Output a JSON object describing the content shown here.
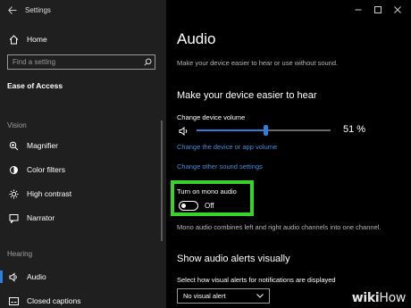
{
  "window": {
    "title": "Settings",
    "back_icon": "back-arrow-icon",
    "controls": [
      "minimize",
      "maximize",
      "close"
    ]
  },
  "sidebar": {
    "home_label": "Home",
    "search_placeholder": "Find a setting",
    "section_title": "Ease of Access",
    "vision_label": "Vision",
    "vision_items": [
      {
        "label": "Magnifier",
        "icon": "magnifier-icon"
      },
      {
        "label": "Color filters",
        "icon": "color-filters-icon"
      },
      {
        "label": "High contrast",
        "icon": "high-contrast-icon"
      },
      {
        "label": "Narrator",
        "icon": "narrator-icon"
      }
    ],
    "hearing_label": "Hearing",
    "hearing_items": [
      {
        "label": "Audio",
        "icon": "audio-icon",
        "selected": true
      },
      {
        "label": "Closed captions",
        "icon": "closed-captions-icon"
      }
    ],
    "accent_color": "#2e7fd9"
  },
  "main": {
    "title": "Audio",
    "subtitle": "Make your device easier to hear or use without sound.",
    "section1_heading": "Make your device easier to hear",
    "volume_label": "Change device volume",
    "volume_percent": 51,
    "volume_display": "51 %",
    "link_app_volume": "Change the device or app volume",
    "link_sound_settings": "Change other sound settings",
    "mono_label": "Turn on mono audio",
    "mono_state": "Off",
    "mono_on": false,
    "mono_description": "Mono audio combines left and right audio channels into one channel.",
    "section2_heading": "Show audio alerts visually",
    "alerts_label": "Select how visual alerts for notifications are displayed",
    "alerts_selected": "No visual alert",
    "highlight_color": "#36d32b",
    "link_color": "#3c8fdc"
  },
  "watermark": {
    "brand_bold": "wiki",
    "brand_rest": "How"
  }
}
